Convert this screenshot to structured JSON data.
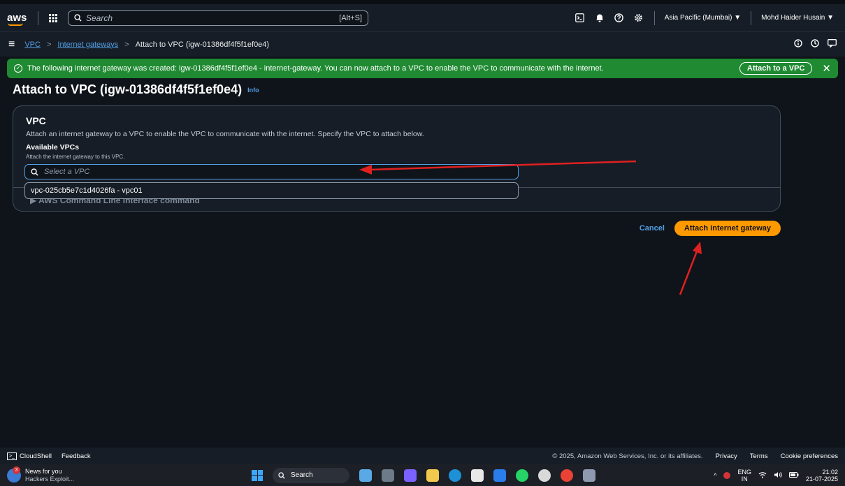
{
  "header": {
    "logo": "aws",
    "search_placeholder": "Search",
    "search_shortcut": "[Alt+S]",
    "region": "Asia Pacific (Mumbai) ▼",
    "user": "Mohd Haider Husain ▼"
  },
  "breadcrumb": {
    "items": [
      "VPC",
      "Internet gateways"
    ],
    "current": "Attach to VPC (igw-01386df4f5f1ef0e4)"
  },
  "flash": {
    "message": "The following internet gateway was created: igw-01386df4f5f1ef0e4 - internet-gateway. You can now attach to a VPC to enable the VPC to communicate with the internet.",
    "button": "Attach to a VPC"
  },
  "page": {
    "title": "Attach to VPC (igw-01386df4f5f1ef0e4)",
    "info": "Info"
  },
  "panel": {
    "title": "VPC",
    "description": "Attach an internet gateway to a VPC to enable the VPC to communicate with the internet. Specify the VPC to attach below.",
    "field_label": "Available VPCs",
    "field_description": "Attach the internet gateway to this VPC.",
    "placeholder": "Select a VPC",
    "option": "vpc-025cb5e7c1d4026fa - vpc01",
    "cli_section": "▶ AWS Command Line Interface command"
  },
  "actions": {
    "cancel": "Cancel",
    "submit": "Attach internet gateway"
  },
  "footer": {
    "cloudshell": "CloudShell",
    "feedback": "Feedback",
    "copyright": "© 2025, Amazon Web Services, Inc. or its affiliates.",
    "privacy": "Privacy",
    "terms": "Terms",
    "cookies": "Cookie preferences"
  },
  "taskbar": {
    "news_title": "News for you",
    "news_sub": "Hackers Exploit...",
    "news_badge": "3",
    "search": "Search",
    "lang_top": "ENG",
    "lang_bottom": "IN",
    "time": "21:02",
    "date": "21-07-2025"
  },
  "colors": {
    "accent_orange": "#ff9900",
    "link_blue": "#539fe5",
    "success_green": "#1f8a32",
    "annotation_red": "#e02020"
  }
}
